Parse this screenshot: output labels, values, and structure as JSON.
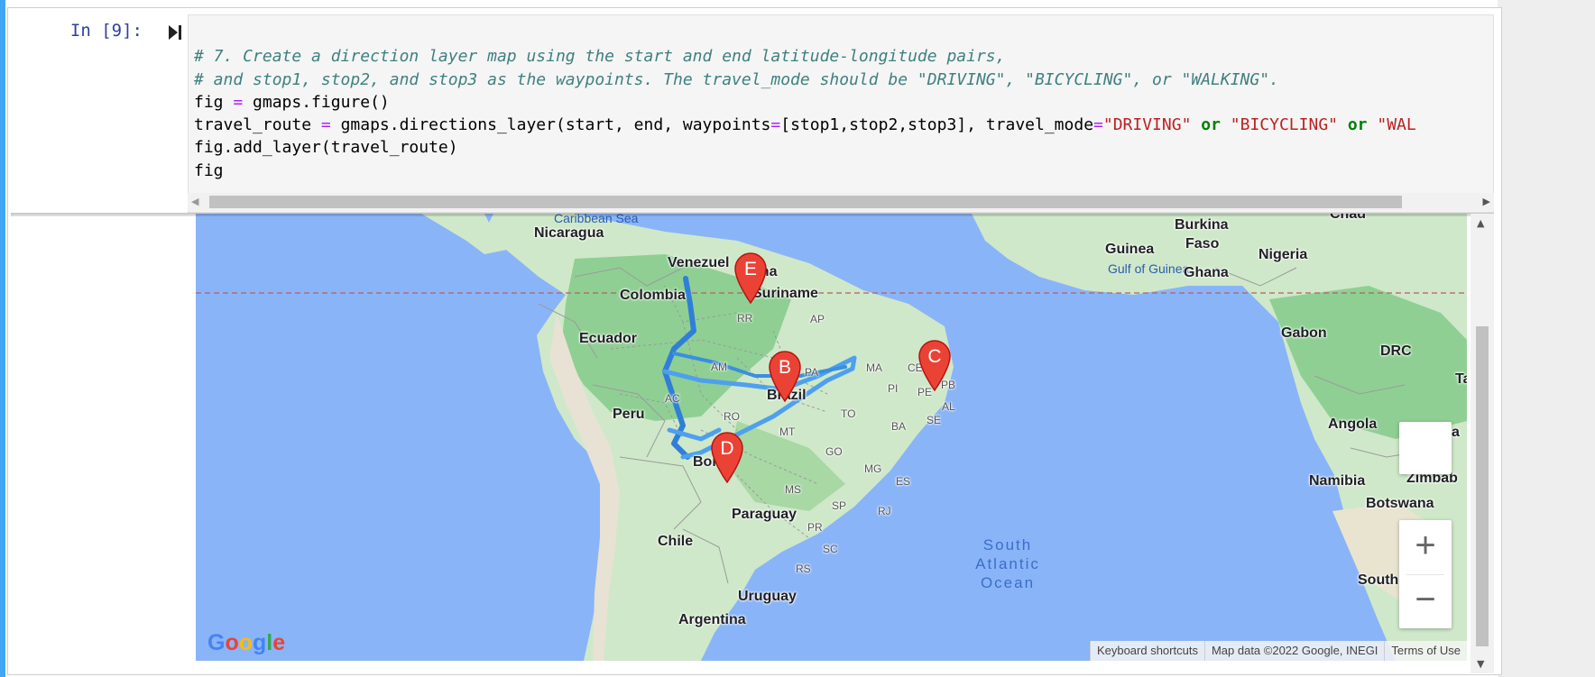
{
  "cell": {
    "prompt": "In [9]:",
    "code": {
      "line1": "# 7. Create a direction layer map using the start and end latitude-longitude pairs,",
      "line2": "# and stop1, stop2, and stop3 as the waypoints. The travel_mode should be \"DRIVING\", \"BICYCLING\", or \"WALKING\".",
      "line3_var": "fig ",
      "line3_op": "=",
      "line3_rest": " gmaps.figure()",
      "line4_var": "travel_route ",
      "line4_op": "=",
      "line4_call": " gmaps.directions_layer(start, end, waypoints",
      "line4_op2": "=",
      "line4_args": "[stop1,stop2,stop3], travel_mode",
      "line4_op3": "=",
      "line4_str1": "\"DRIVING\"",
      "line4_kw1": " or ",
      "line4_str2": "\"BICYCLING\"",
      "line4_kw2": " or ",
      "line4_str3": "\"WAL",
      "line5": "fig.add_layer(travel_route)",
      "line6": "fig"
    }
  },
  "map": {
    "water_labels": {
      "caribbean": "Caribbean Sea",
      "gulf_guinea": "Gulf of Guinea",
      "ocean_line1": "South",
      "ocean_line2": "Atlantic",
      "ocean_line3": "Ocean"
    },
    "countries": {
      "nicaragua": "Nicaragua",
      "venezuela": "Venezuel",
      "guyana": "yana",
      "suriname": "Suriname",
      "colombia": "Colombia",
      "ecuador": "Ecuador",
      "peru": "Peru",
      "brazil": "Brazil",
      "bolivia": "Bol",
      "paraguay": "Paraguay",
      "chile": "Chile",
      "uruguay": "Uruguay",
      "argentina": "Argentina",
      "burkina": "Burkina",
      "faso": "Faso",
      "guinea": "Guinea",
      "ghana": "Ghana",
      "nigeria": "Nigeria",
      "chad": "Chad",
      "gabon": "Gabon",
      "drc": "DRC",
      "tanzania_cut": "Ta",
      "angola": "Angola",
      "zambia_cut": "a",
      "namibia": "Namibia",
      "zimbabwe": "Zimbab",
      "botswana": "Botswana",
      "south_africa": "South"
    },
    "states": {
      "rr": "RR",
      "ap": "AP",
      "am": "AM",
      "pa": "PA",
      "ma": "MA",
      "ce": "CE",
      "pb": "PB",
      "pi": "PI",
      "pe": "PE",
      "al": "AL",
      "ac": "AC",
      "ro": "RO",
      "to": "TO",
      "ba": "BA",
      "se": "SE",
      "mt": "MT",
      "go": "GO",
      "mg": "MG",
      "es": "ES",
      "ms": "MS",
      "sp": "SP",
      "rj": "RJ",
      "pr": "PR",
      "sc": "SC",
      "rs": "RS"
    },
    "markers": {
      "b": "B",
      "c": "C",
      "d": "D",
      "e": "E"
    },
    "controls": {
      "zoom_in": "+",
      "zoom_out": "−"
    },
    "google_logo": "Google",
    "attribution": {
      "shortcuts": "Keyboard shortcuts",
      "map_data": "Map data ©2022 Google, INEGI",
      "terms": "Terms of Use"
    }
  },
  "colors": {
    "cell_active": "#42a5f5",
    "water": "#8ab4f8",
    "land": "#cfe8c9",
    "forest": "#8fcf94",
    "route": "#3a8fe0",
    "marker": "#ea4335"
  }
}
